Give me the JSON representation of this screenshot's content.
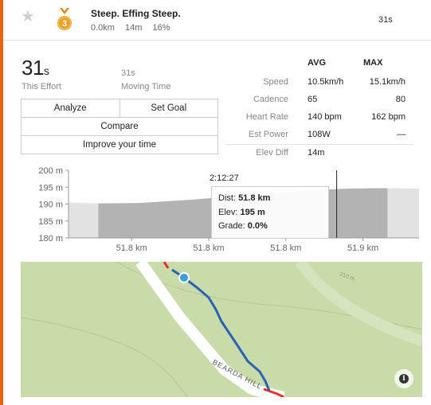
{
  "colors": {
    "accent": "#e8650f",
    "route": "#2a62b8",
    "route_other": "#e6322a",
    "map_bg": "#c9dba9",
    "elev_fill": "#b3b3b3"
  },
  "segment": {
    "star_icon": "star-icon",
    "medal_rank": "3",
    "name": "Steep. Effing Steep.",
    "distance": "0.0km",
    "elev_gain": "14m",
    "grade": "16%",
    "time": "31s"
  },
  "effort": {
    "time_value": "31",
    "time_unit": "s",
    "time_label": "This Effort",
    "moving_value": "31s",
    "moving_label": "Moving Time"
  },
  "buttons": {
    "analyze": "Analyze",
    "set_goal": "Set Goal",
    "compare": "Compare",
    "improve": "Improve your time"
  },
  "stats": {
    "avg_header": "AVG",
    "max_header": "MAX",
    "rows": [
      {
        "label": "Speed",
        "avg": "10.5km/h",
        "max": "15.1km/h"
      },
      {
        "label": "Cadence",
        "avg": "65",
        "max": "80"
      },
      {
        "label": "Heart Rate",
        "avg": "140 bpm",
        "max": "162 bpm"
      },
      {
        "label": "Est Power",
        "avg": "108W",
        "max": "—"
      },
      {
        "label": "Elev Diff",
        "avg": "14m",
        "max": ""
      }
    ]
  },
  "chart_data": {
    "type": "area",
    "y_ticks": [
      "200 m",
      "195 m",
      "190 m",
      "185 m",
      "180 m"
    ],
    "ylim": [
      180,
      200
    ],
    "x_ticks": [
      "51.8 km",
      "51.8 km",
      "51.8 km",
      "51.9 km"
    ],
    "elevation_profile": [
      {
        "x": 0.0,
        "y": 190.5
      },
      {
        "x": 0.07,
        "y": 190.2
      },
      {
        "x": 0.2,
        "y": 190.3
      },
      {
        "x": 0.35,
        "y": 191.3
      },
      {
        "x": 0.5,
        "y": 192.5
      },
      {
        "x": 0.65,
        "y": 193.8
      },
      {
        "x": 0.8,
        "y": 194.6
      },
      {
        "x": 0.9,
        "y": 194.7
      },
      {
        "x": 1.0,
        "y": 194.6
      }
    ],
    "segment_range": [
      0.085,
      0.91
    ],
    "cursor_x": 0.765,
    "cursor_time": "2:12:27",
    "tooltip": {
      "dist_label": "Dist:",
      "dist": "51.8 km",
      "elev_label": "Elev:",
      "elev": "195 m",
      "grade_label": "Grade:",
      "grade": "0.0%"
    }
  },
  "map": {
    "road_label": "BEARDA HILL",
    "contour_label": "210 m",
    "info_icon": "info-icon"
  }
}
